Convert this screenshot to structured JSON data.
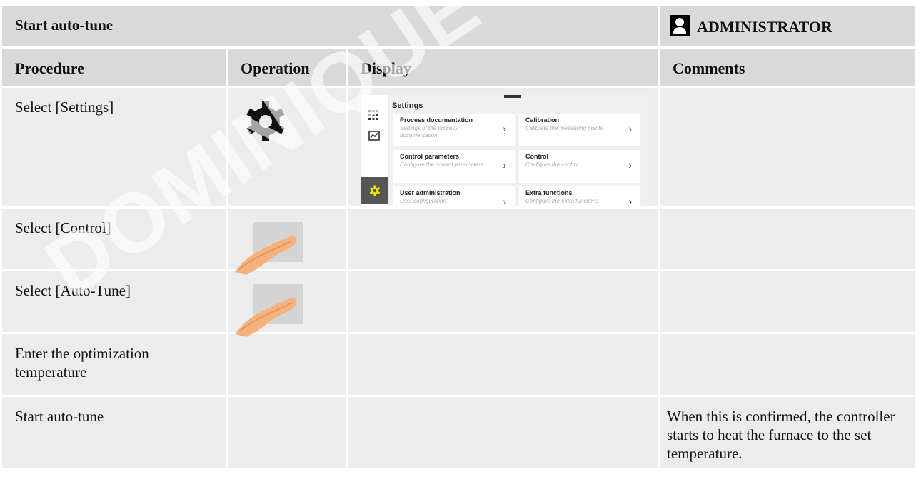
{
  "header": {
    "title": "Start auto-tune",
    "role": "ADMINISTRATOR"
  },
  "columns": [
    "Procedure",
    "Operation",
    "Display",
    "Comments"
  ],
  "rows": [
    {
      "procedure": "Select [Settings]",
      "comment": ""
    },
    {
      "procedure": "Select [Control]",
      "comment": ""
    },
    {
      "procedure": "Select [Auto-Tune]",
      "comment": ""
    },
    {
      "procedure": "Enter the optimization temperature",
      "comment": ""
    },
    {
      "procedure": "Start auto-tune",
      "comment": "When this is confirmed, the controller starts to heat the furnace to the set temperature."
    }
  ],
  "settings_screen": {
    "title": "Settings",
    "tiles": [
      {
        "title": "Process documentation",
        "subtitle": "Settings of the process documentation"
      },
      {
        "title": "Calibration",
        "subtitle": "Calibrate the measuring points"
      },
      {
        "title": "Control parameters",
        "subtitle": "Configure the control parameters"
      },
      {
        "title": "Control",
        "subtitle": "Configure the control"
      },
      {
        "title": "User administration",
        "subtitle": "User configuration"
      },
      {
        "title": "Extra functions",
        "subtitle": "Configure the extra functions"
      }
    ],
    "accent_color": "#f2e200"
  },
  "watermark": "DOMINIQUE DUTSCHER",
  "icons": [
    "admin-user-icon",
    "gear-icon",
    "touch-hand-icon",
    "apps-grid-icon",
    "chart-icon",
    "settings-gear-icon",
    "chevron-right-icon"
  ]
}
